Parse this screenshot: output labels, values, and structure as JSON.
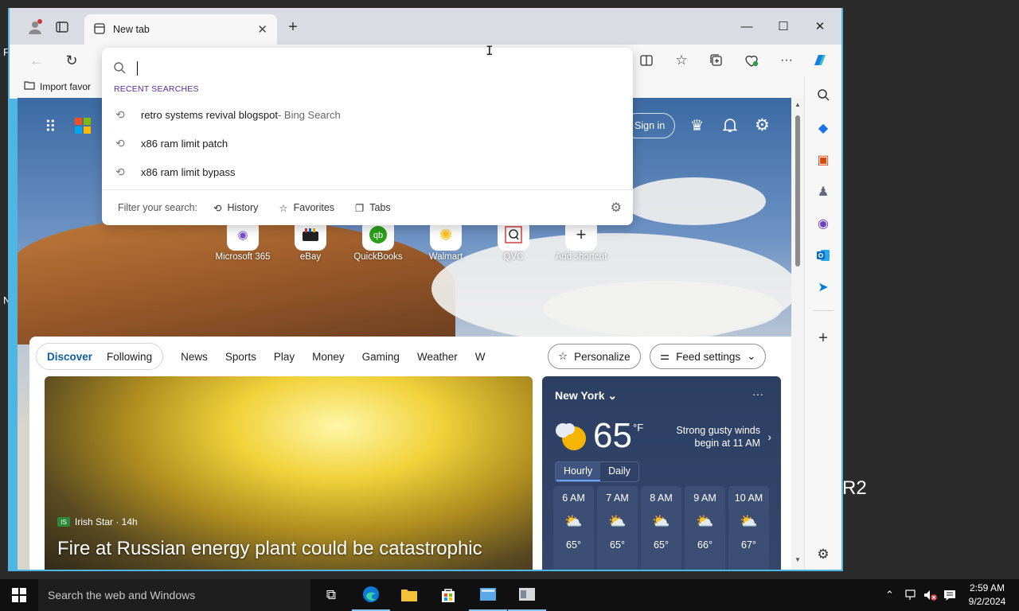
{
  "desktop": {
    "left_fragment_1": "F",
    "left_fragment_2": "N",
    "right_fragment": "R2"
  },
  "browser": {
    "tab_title": "New tab",
    "favorites_bar": {
      "import_label": "Import favor"
    }
  },
  "suggestions": {
    "heading": "RECENT SEARCHES",
    "items": [
      {
        "text": "retro systems revival blogspot",
        "sub": " - Bing Search"
      },
      {
        "text": "x86 ram limit patch",
        "sub": ""
      },
      {
        "text": "x86 ram limit bypass",
        "sub": ""
      }
    ],
    "filter_label": "Filter your search:",
    "filters": [
      "History",
      "Favorites",
      "Tabs"
    ]
  },
  "msn": {
    "sign_in": "Sign in",
    "quick_links": [
      "Microsoft 365",
      "eBay",
      "QuickBooks",
      "Walmart",
      "QVC",
      "Add shortcut"
    ]
  },
  "feed": {
    "seg_tabs": [
      "Discover",
      "Following"
    ],
    "nav": [
      "News",
      "Sports",
      "Play",
      "Money",
      "Gaming",
      "Weather",
      "W"
    ],
    "personalize": "Personalize",
    "feed_settings": "Feed settings",
    "hero": {
      "source": "Irish Star · 14h",
      "headline": "Fire at Russian energy plant could be catastrophic"
    }
  },
  "weather": {
    "city": "New York",
    "temp": "65",
    "unit": "°F",
    "condition_line1": "Strong gusty winds",
    "condition_line2": "begin at 11 AM",
    "tabs": [
      "Hourly",
      "Daily"
    ],
    "hours": [
      {
        "time": "6 AM",
        "temp": "65°"
      },
      {
        "time": "7 AM",
        "temp": "65°"
      },
      {
        "time": "8 AM",
        "temp": "65°"
      },
      {
        "time": "9 AM",
        "temp": "66°"
      },
      {
        "time": "10 AM",
        "temp": "67°"
      }
    ]
  },
  "taskbar": {
    "search_placeholder": "Search the web and Windows",
    "time": "2:59 AM",
    "date": "9/2/2024"
  }
}
